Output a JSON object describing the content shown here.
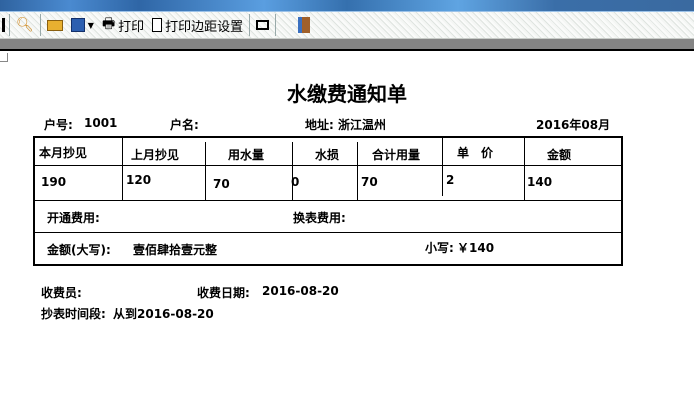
{
  "toolbar": {
    "items": [
      {
        "icon": "magnifier-icon"
      },
      {
        "icon": "open-folder-icon"
      },
      {
        "icon": "save-icon"
      },
      {
        "icon": "printer-icon",
        "label": "打印"
      },
      {
        "icon": "page-icon",
        "label": "打印边距设置"
      },
      {
        "icon": "frame-icon"
      },
      {
        "icon": "exit-door-icon"
      }
    ]
  },
  "document": {
    "title": "水缴费通知单",
    "account_label": "户号:",
    "account_value": "1001",
    "name_label": "户名:",
    "address_label": "地址:",
    "address_value": "浙江温州",
    "period": "2016年08月",
    "table": {
      "headers": [
        "本月抄见",
        "上月抄见",
        "用水量",
        "水损",
        "合计用量",
        "单　价",
        "金额"
      ],
      "values": [
        "190",
        "120",
        "70",
        "0",
        "70",
        "2",
        "140"
      ]
    },
    "open_fee_label": "开通费用:",
    "replace_fee_label": "换表费用:",
    "amount_upper_label": "金额(大写):",
    "amount_upper_value": "壹佰肆拾壹元整",
    "amount_lower_label": "小写:",
    "amount_lower_value": "￥140",
    "collector_label": "收费员:",
    "date_label": "收费日期:",
    "date_value": "2016-08-20",
    "reading_period_label": "抄表时间段:",
    "reading_period_value": "从到2016-08-20"
  }
}
